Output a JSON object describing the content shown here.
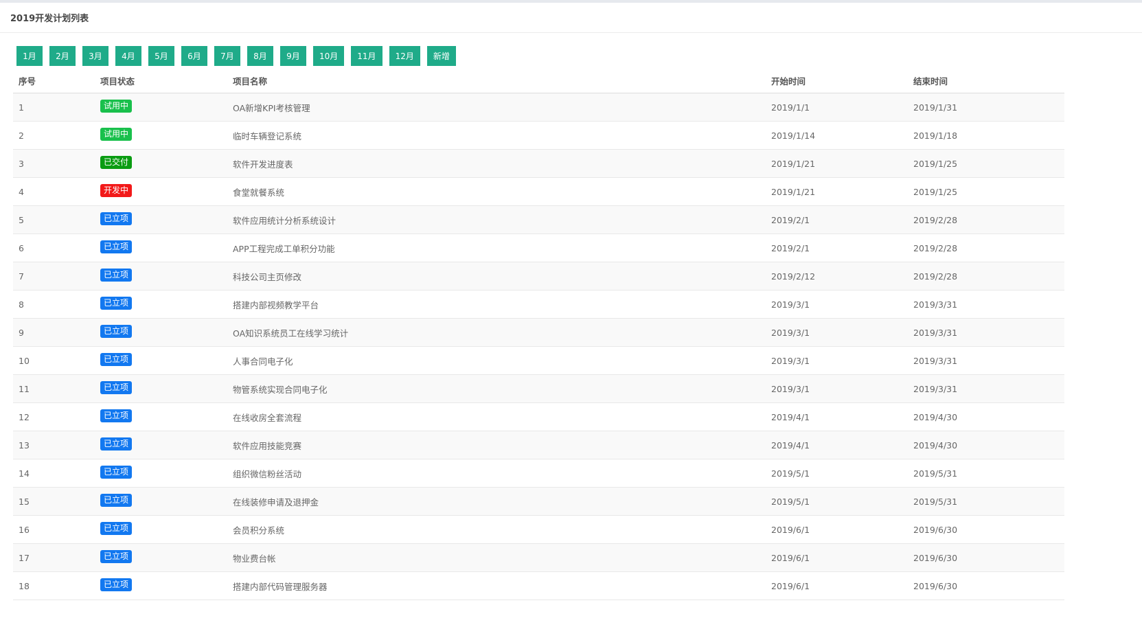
{
  "page": {
    "title": "2019开发计划列表"
  },
  "months": [
    "1月",
    "2月",
    "3月",
    "4月",
    "5月",
    "6月",
    "7月",
    "8月",
    "9月",
    "10月",
    "11月",
    "12月"
  ],
  "add_label": "新增",
  "colors": {
    "accent": "#1fab89",
    "trial": "#19c04c",
    "delivered": "#0a9c12",
    "dev": "#f21919",
    "approved": "#1278f0"
  },
  "table": {
    "headers": [
      "序号",
      "项目状态",
      "项目名称",
      "开始时间",
      "结束时间"
    ],
    "rows": [
      {
        "idx": "1",
        "status": "试用中",
        "status_type": "trial",
        "name": "OA新增KPI考核管理",
        "start": "2019/1/1",
        "end": "2019/1/31"
      },
      {
        "idx": "2",
        "status": "试用中",
        "status_type": "trial",
        "name": "临时车辆登记系统",
        "start": "2019/1/14",
        "end": "2019/1/18"
      },
      {
        "idx": "3",
        "status": "已交付",
        "status_type": "delivered",
        "name": "软件开发进度表",
        "start": "2019/1/21",
        "end": "2019/1/25"
      },
      {
        "idx": "4",
        "status": "开发中",
        "status_type": "dev",
        "name": "食堂就餐系统",
        "start": "2019/1/21",
        "end": "2019/1/25"
      },
      {
        "idx": "5",
        "status": "已立项",
        "status_type": "approved",
        "name": "软件应用统计分析系统设计",
        "start": "2019/2/1",
        "end": "2019/2/28"
      },
      {
        "idx": "6",
        "status": "已立项",
        "status_type": "approved",
        "name": "APP工程完成工单积分功能",
        "start": "2019/2/1",
        "end": "2019/2/28"
      },
      {
        "idx": "7",
        "status": "已立项",
        "status_type": "approved",
        "name": "科技公司主页修改",
        "start": "2019/2/12",
        "end": "2019/2/28"
      },
      {
        "idx": "8",
        "status": "已立项",
        "status_type": "approved",
        "name": "搭建内部视频教学平台",
        "start": "2019/3/1",
        "end": "2019/3/31"
      },
      {
        "idx": "9",
        "status": "已立项",
        "status_type": "approved",
        "name": "OA知识系统员工在线学习统计",
        "start": "2019/3/1",
        "end": "2019/3/31"
      },
      {
        "idx": "10",
        "status": "已立项",
        "status_type": "approved",
        "name": "人事合同电子化",
        "start": "2019/3/1",
        "end": "2019/3/31"
      },
      {
        "idx": "11",
        "status": "已立项",
        "status_type": "approved",
        "name": "物管系统实现合同电子化",
        "start": "2019/3/1",
        "end": "2019/3/31"
      },
      {
        "idx": "12",
        "status": "已立项",
        "status_type": "approved",
        "name": "在线收房全套流程",
        "start": "2019/4/1",
        "end": "2019/4/30"
      },
      {
        "idx": "13",
        "status": "已立项",
        "status_type": "approved",
        "name": "软件应用技能竞赛",
        "start": "2019/4/1",
        "end": "2019/4/30"
      },
      {
        "idx": "14",
        "status": "已立项",
        "status_type": "approved",
        "name": "组织微信粉丝活动",
        "start": "2019/5/1",
        "end": "2019/5/31"
      },
      {
        "idx": "15",
        "status": "已立项",
        "status_type": "approved",
        "name": "在线装修申请及退押金",
        "start": "2019/5/1",
        "end": "2019/5/31"
      },
      {
        "idx": "16",
        "status": "已立项",
        "status_type": "approved",
        "name": "会员积分系统",
        "start": "2019/6/1",
        "end": "2019/6/30"
      },
      {
        "idx": "17",
        "status": "已立项",
        "status_type": "approved",
        "name": "物业费台帐",
        "start": "2019/6/1",
        "end": "2019/6/30"
      },
      {
        "idx": "18",
        "status": "已立项",
        "status_type": "approved",
        "name": "搭建内部代码管理服务器",
        "start": "2019/6/1",
        "end": "2019/6/30"
      }
    ]
  }
}
